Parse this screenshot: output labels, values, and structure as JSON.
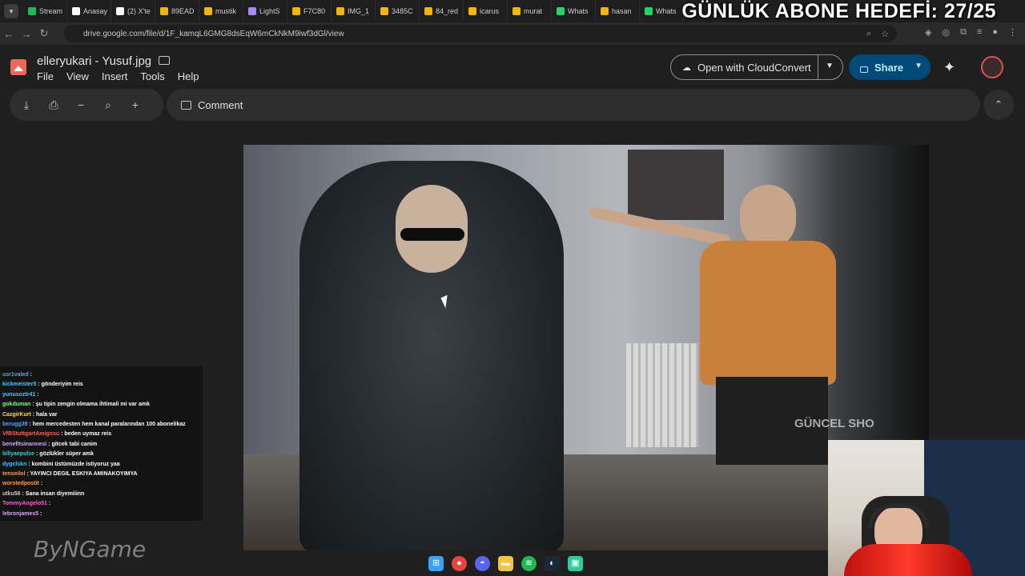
{
  "overlay": {
    "goal_text": "GÜNLÜK ABONE HEDEFİ: 27/25"
  },
  "browser": {
    "tabs": [
      {
        "label": "Stream",
        "icon": "spotify-icon",
        "color": "#1db954"
      },
      {
        "label": "Anasay",
        "icon": "x-icon",
        "color": "#ffffff"
      },
      {
        "label": "(2) X'te",
        "icon": "x-icon",
        "color": "#ffffff"
      },
      {
        "label": "89EAD",
        "icon": "drive-icon",
        "color": "#f4b400"
      },
      {
        "label": "mustik",
        "icon": "drive-icon",
        "color": "#f4b400"
      },
      {
        "label": "LightS",
        "icon": "pen-icon",
        "color": "#a78bfa"
      },
      {
        "label": "F7C80",
        "icon": "drive-icon",
        "color": "#f4b400"
      },
      {
        "label": "IMG_1",
        "icon": "drive-icon",
        "color": "#f4b400"
      },
      {
        "label": "3485C",
        "icon": "drive-icon",
        "color": "#f4b400"
      },
      {
        "label": "84_red",
        "icon": "drive-icon",
        "color": "#f4b400"
      },
      {
        "label": "icarus",
        "icon": "drive-icon",
        "color": "#f4b400"
      },
      {
        "label": "murat",
        "icon": "drive-icon",
        "color": "#f4b400"
      },
      {
        "label": "Whats",
        "icon": "whatsapp-icon",
        "color": "#25d366"
      },
      {
        "label": "hasan",
        "icon": "drive-icon",
        "color": "#f4b400"
      },
      {
        "label": "Whats",
        "icon": "whatsapp-icon",
        "color": "#25d366"
      }
    ],
    "url": "drive.google.com/file/d/1F_kamqL6GMG8dsEqW6mCkNkM9iwf3dGl/view"
  },
  "drive": {
    "file_name": "elleryukari - Yusuf.jpg",
    "menu": [
      "File",
      "View",
      "Insert",
      "Tools",
      "Help"
    ],
    "open_with_label": "Open with CloudConvert",
    "share_label": "Share",
    "comment_label": "Comment"
  },
  "image_overlay": {
    "watermark": "GÜNCEL SHO"
  },
  "chat": [
    {
      "user": "usr1valed",
      "msg": ":",
      "color": "#5b9bff"
    },
    {
      "user": "kickmeister5",
      "msg": ": gönderiyim reis",
      "color": "#42c8ff"
    },
    {
      "user": "yunusoztr41",
      "msg": ":",
      "color": "#42c8ff"
    },
    {
      "user": "gokduman",
      "msg": ": şu tipin zengin olmama ihtimali mi var amk",
      "color": "#7cff7c"
    },
    {
      "user": "CazgirKurt",
      "msg": ": hala var",
      "color": "#ffd84a"
    },
    {
      "user": "berugg39",
      "msg": ": hem mercedesten hem kanal paralarından 100 abonelikaz",
      "color": "#4aa8ff"
    },
    {
      "user": "VfBStuttgartAmigosu",
      "msg": ": beden uymaz reis",
      "color": "#ff5c5c"
    },
    {
      "user": "benefitsinannesi",
      "msg": ": gitcek tabi canim",
      "color": "#d5a5ff"
    },
    {
      "user": "billyaepulse",
      "msg": ": gözlükler süper amk",
      "color": "#3fd0c9"
    },
    {
      "user": "dygclskn",
      "msg": ": kombini üstümüzde istiyoruz yaa",
      "color": "#42c8ff"
    },
    {
      "user": "tenseilol",
      "msg": ": YAYINCI DEGIL ESKIYA AMINAKOYIMYA",
      "color": "#ff9c42"
    },
    {
      "user": "worstedpostit",
      "msg": ":",
      "color": "#ff9c42"
    },
    {
      "user": "utku56",
      "msg": ": Sana insan diyemiiinn",
      "color": "#c8c8c8"
    },
    {
      "user": "TommyAngelo51",
      "msg": ":",
      "color": "#ff5cd6"
    },
    {
      "user": "lebronjames5",
      "msg": ":",
      "color": "#d5a5ff"
    }
  ],
  "logo_text": "ByNGame"
}
